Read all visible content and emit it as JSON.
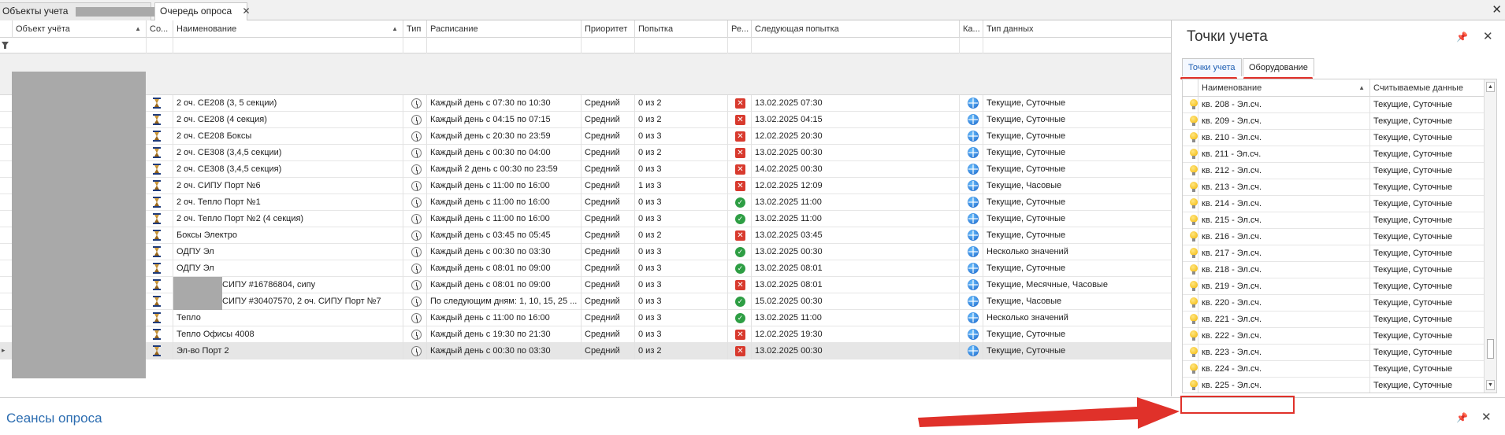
{
  "tabs": [
    {
      "label": "Объекты учета"
    },
    {
      "label": "Очередь опроса"
    }
  ],
  "grid": {
    "columns": [
      "Объект учёта",
      "Со...",
      "Наименование",
      "Тип",
      "Расписание",
      "Приоритет",
      "Попытка",
      "Ре...",
      "Следующая попытка",
      "Ка...",
      "Тип данных"
    ],
    "rows": [
      {
        "name": "2 оч. СЕ208 (3, 5 секции)",
        "schedule": "Каждый день с 07:30 по 10:30",
        "priority": "Средний",
        "attempt": "0 из 2",
        "result": "fail",
        "next": "13.02.2025 07:30",
        "datatype": "Текущие, Суточные"
      },
      {
        "name": "2 оч. СЕ208 (4 секция)",
        "schedule": "Каждый день с 04:15 по 07:15",
        "priority": "Средний",
        "attempt": "0 из 2",
        "result": "fail",
        "next": "13.02.2025 04:15",
        "datatype": "Текущие, Суточные"
      },
      {
        "name": "2 оч. СЕ208 Боксы",
        "schedule": "Каждый день с 20:30 по 23:59",
        "priority": "Средний",
        "attempt": "0 из 3",
        "result": "fail",
        "next": "12.02.2025 20:30",
        "datatype": "Текущие, Суточные"
      },
      {
        "name": "2 оч. СЕ308 (3,4,5 секции)",
        "schedule": "Каждый день с 00:30 по 04:00",
        "priority": "Средний",
        "attempt": "0 из 2",
        "result": "fail",
        "next": "13.02.2025 00:30",
        "datatype": "Текущие, Суточные"
      },
      {
        "name": "2 оч. СЕ308 (3,4,5 секция)",
        "schedule": "Каждый 2 день с 00:30 по 23:59",
        "priority": "Средний",
        "attempt": "0 из 3",
        "result": "fail",
        "next": "14.02.2025 00:30",
        "datatype": "Текущие, Суточные"
      },
      {
        "name": "2 оч. СИПУ Порт №6",
        "schedule": "Каждый день с 11:00 по 16:00",
        "priority": "Средний",
        "attempt": "1 из 3",
        "result": "fail",
        "next": "12.02.2025 12:09",
        "datatype": "Текущие, Часовые"
      },
      {
        "name": "2 оч. Тепло Порт №1",
        "schedule": "Каждый день с 11:00 по 16:00",
        "priority": "Средний",
        "attempt": "0 из 3",
        "result": "ok",
        "next": "13.02.2025 11:00",
        "datatype": "Текущие, Суточные"
      },
      {
        "name": "2 оч. Тепло Порт №2 (4 секция)",
        "schedule": "Каждый день с 11:00 по 16:00",
        "priority": "Средний",
        "attempt": "0 из 3",
        "result": "ok",
        "next": "13.02.2025 11:00",
        "datatype": "Текущие, Суточные"
      },
      {
        "name": "Боксы Электро",
        "schedule": "Каждый день с 03:45 по 05:45",
        "priority": "Средний",
        "attempt": "0 из 2",
        "result": "fail",
        "next": "13.02.2025 03:45",
        "datatype": "Текущие, Суточные"
      },
      {
        "name": "ОДПУ Эл",
        "schedule": "Каждый день с 00:30 по 03:30",
        "priority": "Средний",
        "attempt": "0 из 3",
        "result": "ok",
        "next": "13.02.2025 00:30",
        "datatype": "Несколько значений"
      },
      {
        "name": "ОДПУ Эл",
        "schedule": "Каждый день с 08:01 по 09:00",
        "priority": "Средний",
        "attempt": "0 из 3",
        "result": "ok",
        "next": "13.02.2025 08:01",
        "datatype": "Текущие, Суточные"
      },
      {
        "name": "СИПУ #16786804, сипу",
        "schedule": "Каждый день с 08:01 по 09:00",
        "priority": "Средний",
        "attempt": "0 из 3",
        "result": "fail",
        "next": "13.02.2025 08:01",
        "datatype": "Текущие, Месячные, Часовые"
      },
      {
        "name": "СИПУ #30407570, 2 оч. СИПУ Порт №7",
        "schedule": "По следующим дням: 1, 10, 15, 25 ...",
        "priority": "Средний",
        "attempt": "0 из 3",
        "result": "ok",
        "next": "15.02.2025 00:30",
        "datatype": "Текущие, Часовые"
      },
      {
        "name": "Тепло",
        "schedule": "Каждый день с 11:00 по 16:00",
        "priority": "Средний",
        "attempt": "0 из 3",
        "result": "ok",
        "next": "13.02.2025 11:00",
        "datatype": "Несколько значений"
      },
      {
        "name": "Тепло Офисы 4008",
        "schedule": "Каждый день с 19:30 по 21:30",
        "priority": "Средний",
        "attempt": "0 из 3",
        "result": "fail",
        "next": "12.02.2025 19:30",
        "datatype": "Текущие, Суточные"
      },
      {
        "name": "Эл-во Порт 2",
        "schedule": "Каждый день с 00:30 по 03:30",
        "priority": "Средний",
        "attempt": "0 из 2",
        "result": "fail",
        "next": "13.02.2025 00:30",
        "datatype": "Текущие, Суточные"
      }
    ]
  },
  "panel": {
    "title": "Точки учета",
    "tabs": [
      "Точки учета",
      "Оборудование"
    ],
    "columns": [
      "Наименование",
      "Считываемые данные"
    ],
    "rows": [
      {
        "name": "кв. 208 - Эл.сч.",
        "data": "Текущие, Суточные"
      },
      {
        "name": "кв. 209 - Эл.сч.",
        "data": "Текущие, Суточные"
      },
      {
        "name": "кв. 210 - Эл.сч.",
        "data": "Текущие, Суточные"
      },
      {
        "name": "кв. 211 - Эл.сч.",
        "data": "Текущие, Суточные"
      },
      {
        "name": "кв. 212 - Эл.сч.",
        "data": "Текущие, Суточные"
      },
      {
        "name": "кв. 213 - Эл.сч.",
        "data": "Текущие, Суточные"
      },
      {
        "name": "кв. 214 - Эл.сч.",
        "data": "Текущие, Суточные"
      },
      {
        "name": "кв. 215 - Эл.сч.",
        "data": "Текущие, Суточные"
      },
      {
        "name": "кв. 216 - Эл.сч.",
        "data": "Текущие, Суточные"
      },
      {
        "name": "кв. 217 - Эл.сч.",
        "data": "Текущие, Суточные"
      },
      {
        "name": "кв. 218 - Эл.сч.",
        "data": "Текущие, Суточные"
      },
      {
        "name": "кв. 219 - Эл.сч.",
        "data": "Текущие, Суточные"
      },
      {
        "name": "кв. 220 - Эл.сч.",
        "data": "Текущие, Суточные"
      },
      {
        "name": "кв. 221 - Эл.сч.",
        "data": "Текущие, Суточные"
      },
      {
        "name": "кв. 222 - Эл.сч.",
        "data": "Текущие, Суточные"
      },
      {
        "name": "кв. 223 - Эл.сч.",
        "data": "Текущие, Суточные"
      },
      {
        "name": "кв. 224 - Эл.сч.",
        "data": "Текущие, Суточные"
      },
      {
        "name": "кв. 225 - Эл.сч.",
        "data": "Текущие, Суточные"
      }
    ]
  },
  "bottom": {
    "title": "Сеансы опроса"
  },
  "colors": {
    "accent": "#2b6cb0",
    "annotation": "#e0312a",
    "fail": "#d83a2e",
    "ok": "#2e9e44"
  },
  "icons": {
    "status": "hourglass-icon",
    "type": "alarm-clock-icon",
    "channel": "globe-icon",
    "point": "lightbulb-icon"
  }
}
